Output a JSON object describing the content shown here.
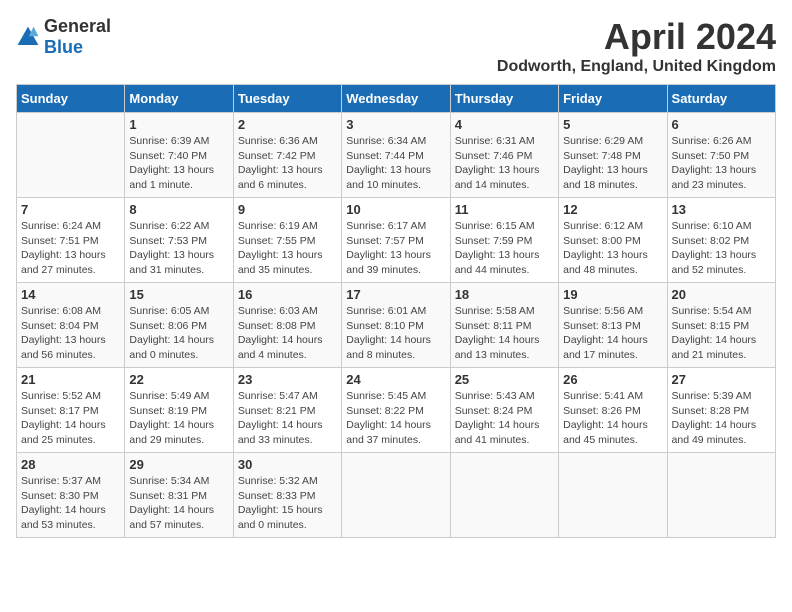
{
  "header": {
    "logo_general": "General",
    "logo_blue": "Blue",
    "month_title": "April 2024",
    "location": "Dodworth, England, United Kingdom"
  },
  "days_of_week": [
    "Sunday",
    "Monday",
    "Tuesday",
    "Wednesday",
    "Thursday",
    "Friday",
    "Saturday"
  ],
  "weeks": [
    [
      {
        "day": "",
        "sunrise": "",
        "sunset": "",
        "daylight": ""
      },
      {
        "day": "1",
        "sunrise": "Sunrise: 6:39 AM",
        "sunset": "Sunset: 7:40 PM",
        "daylight": "Daylight: 13 hours and 1 minute."
      },
      {
        "day": "2",
        "sunrise": "Sunrise: 6:36 AM",
        "sunset": "Sunset: 7:42 PM",
        "daylight": "Daylight: 13 hours and 6 minutes."
      },
      {
        "day": "3",
        "sunrise": "Sunrise: 6:34 AM",
        "sunset": "Sunset: 7:44 PM",
        "daylight": "Daylight: 13 hours and 10 minutes."
      },
      {
        "day": "4",
        "sunrise": "Sunrise: 6:31 AM",
        "sunset": "Sunset: 7:46 PM",
        "daylight": "Daylight: 13 hours and 14 minutes."
      },
      {
        "day": "5",
        "sunrise": "Sunrise: 6:29 AM",
        "sunset": "Sunset: 7:48 PM",
        "daylight": "Daylight: 13 hours and 18 minutes."
      },
      {
        "day": "6",
        "sunrise": "Sunrise: 6:26 AM",
        "sunset": "Sunset: 7:50 PM",
        "daylight": "Daylight: 13 hours and 23 minutes."
      }
    ],
    [
      {
        "day": "7",
        "sunrise": "Sunrise: 6:24 AM",
        "sunset": "Sunset: 7:51 PM",
        "daylight": "Daylight: 13 hours and 27 minutes."
      },
      {
        "day": "8",
        "sunrise": "Sunrise: 6:22 AM",
        "sunset": "Sunset: 7:53 PM",
        "daylight": "Daylight: 13 hours and 31 minutes."
      },
      {
        "day": "9",
        "sunrise": "Sunrise: 6:19 AM",
        "sunset": "Sunset: 7:55 PM",
        "daylight": "Daylight: 13 hours and 35 minutes."
      },
      {
        "day": "10",
        "sunrise": "Sunrise: 6:17 AM",
        "sunset": "Sunset: 7:57 PM",
        "daylight": "Daylight: 13 hours and 39 minutes."
      },
      {
        "day": "11",
        "sunrise": "Sunrise: 6:15 AM",
        "sunset": "Sunset: 7:59 PM",
        "daylight": "Daylight: 13 hours and 44 minutes."
      },
      {
        "day": "12",
        "sunrise": "Sunrise: 6:12 AM",
        "sunset": "Sunset: 8:00 PM",
        "daylight": "Daylight: 13 hours and 48 minutes."
      },
      {
        "day": "13",
        "sunrise": "Sunrise: 6:10 AM",
        "sunset": "Sunset: 8:02 PM",
        "daylight": "Daylight: 13 hours and 52 minutes."
      }
    ],
    [
      {
        "day": "14",
        "sunrise": "Sunrise: 6:08 AM",
        "sunset": "Sunset: 8:04 PM",
        "daylight": "Daylight: 13 hours and 56 minutes."
      },
      {
        "day": "15",
        "sunrise": "Sunrise: 6:05 AM",
        "sunset": "Sunset: 8:06 PM",
        "daylight": "Daylight: 14 hours and 0 minutes."
      },
      {
        "day": "16",
        "sunrise": "Sunrise: 6:03 AM",
        "sunset": "Sunset: 8:08 PM",
        "daylight": "Daylight: 14 hours and 4 minutes."
      },
      {
        "day": "17",
        "sunrise": "Sunrise: 6:01 AM",
        "sunset": "Sunset: 8:10 PM",
        "daylight": "Daylight: 14 hours and 8 minutes."
      },
      {
        "day": "18",
        "sunrise": "Sunrise: 5:58 AM",
        "sunset": "Sunset: 8:11 PM",
        "daylight": "Daylight: 14 hours and 13 minutes."
      },
      {
        "day": "19",
        "sunrise": "Sunrise: 5:56 AM",
        "sunset": "Sunset: 8:13 PM",
        "daylight": "Daylight: 14 hours and 17 minutes."
      },
      {
        "day": "20",
        "sunrise": "Sunrise: 5:54 AM",
        "sunset": "Sunset: 8:15 PM",
        "daylight": "Daylight: 14 hours and 21 minutes."
      }
    ],
    [
      {
        "day": "21",
        "sunrise": "Sunrise: 5:52 AM",
        "sunset": "Sunset: 8:17 PM",
        "daylight": "Daylight: 14 hours and 25 minutes."
      },
      {
        "day": "22",
        "sunrise": "Sunrise: 5:49 AM",
        "sunset": "Sunset: 8:19 PM",
        "daylight": "Daylight: 14 hours and 29 minutes."
      },
      {
        "day": "23",
        "sunrise": "Sunrise: 5:47 AM",
        "sunset": "Sunset: 8:21 PM",
        "daylight": "Daylight: 14 hours and 33 minutes."
      },
      {
        "day": "24",
        "sunrise": "Sunrise: 5:45 AM",
        "sunset": "Sunset: 8:22 PM",
        "daylight": "Daylight: 14 hours and 37 minutes."
      },
      {
        "day": "25",
        "sunrise": "Sunrise: 5:43 AM",
        "sunset": "Sunset: 8:24 PM",
        "daylight": "Daylight: 14 hours and 41 minutes."
      },
      {
        "day": "26",
        "sunrise": "Sunrise: 5:41 AM",
        "sunset": "Sunset: 8:26 PM",
        "daylight": "Daylight: 14 hours and 45 minutes."
      },
      {
        "day": "27",
        "sunrise": "Sunrise: 5:39 AM",
        "sunset": "Sunset: 8:28 PM",
        "daylight": "Daylight: 14 hours and 49 minutes."
      }
    ],
    [
      {
        "day": "28",
        "sunrise": "Sunrise: 5:37 AM",
        "sunset": "Sunset: 8:30 PM",
        "daylight": "Daylight: 14 hours and 53 minutes."
      },
      {
        "day": "29",
        "sunrise": "Sunrise: 5:34 AM",
        "sunset": "Sunset: 8:31 PM",
        "daylight": "Daylight: 14 hours and 57 minutes."
      },
      {
        "day": "30",
        "sunrise": "Sunrise: 5:32 AM",
        "sunset": "Sunset: 8:33 PM",
        "daylight": "Daylight: 15 hours and 0 minutes."
      },
      {
        "day": "",
        "sunrise": "",
        "sunset": "",
        "daylight": ""
      },
      {
        "day": "",
        "sunrise": "",
        "sunset": "",
        "daylight": ""
      },
      {
        "day": "",
        "sunrise": "",
        "sunset": "",
        "daylight": ""
      },
      {
        "day": "",
        "sunrise": "",
        "sunset": "",
        "daylight": ""
      }
    ]
  ]
}
